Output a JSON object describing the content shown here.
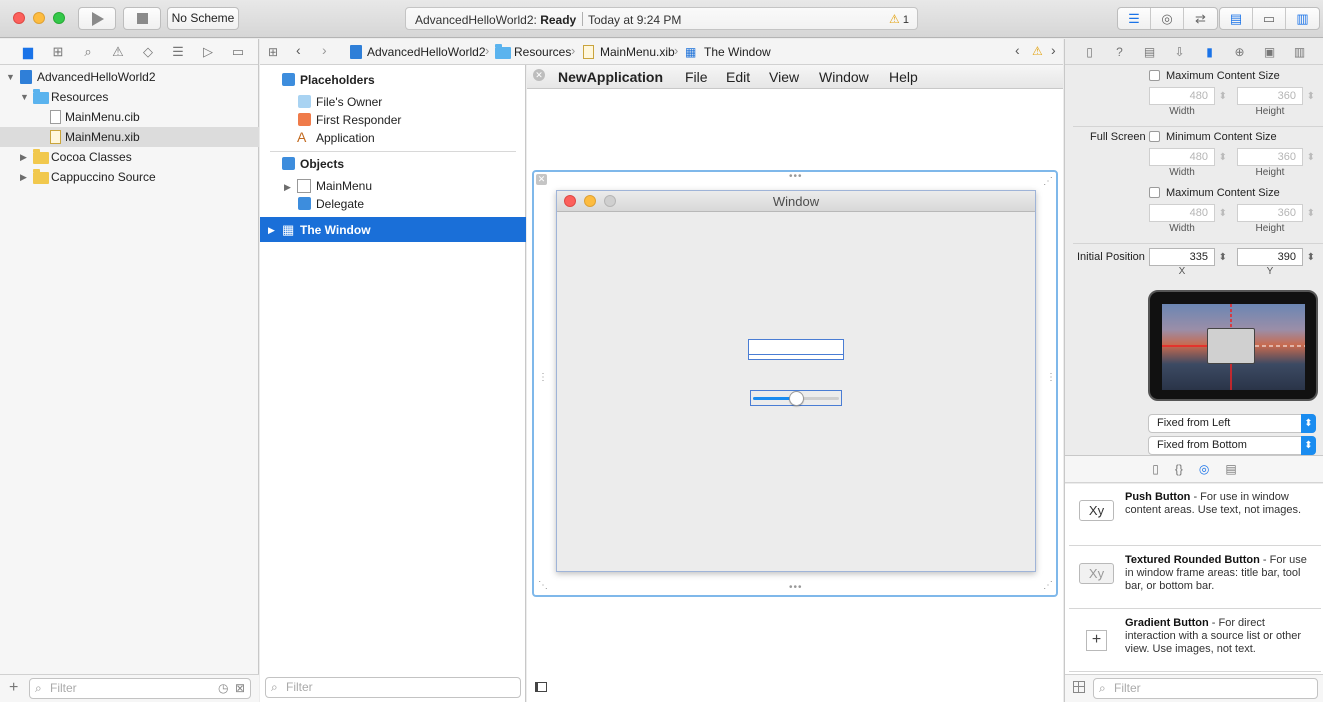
{
  "toolbar": {
    "scheme": "No Scheme",
    "project": "AdvancedHelloWorld2:",
    "status": "Ready",
    "time": "Today at 9:24 PM",
    "warning_count": "1"
  },
  "navigator": {
    "items": [
      {
        "label": "AdvancedHelloWorld2"
      },
      {
        "label": "Resources"
      },
      {
        "label": "MainMenu.cib"
      },
      {
        "label": "MainMenu.xib"
      },
      {
        "label": "Cocoa Classes"
      },
      {
        "label": "Cappuccino Source"
      }
    ],
    "filter_placeholder": "Filter"
  },
  "jumpbar": {
    "crumbs": [
      "AdvancedHelloWorld2",
      "Resources",
      "MainMenu.xib",
      "The Window"
    ]
  },
  "outline": {
    "placeholders_title": "Placeholders",
    "placeholders": [
      "File's Owner",
      "First Responder",
      "Application"
    ],
    "objects_title": "Objects",
    "objects": [
      "MainMenu",
      "Delegate"
    ],
    "selected": "The Window",
    "filter_placeholder": "Filter"
  },
  "canvas": {
    "menu": {
      "app": "NewApplication",
      "items": [
        "File",
        "Edit",
        "View",
        "Window",
        "Help"
      ]
    },
    "window_title": "Window",
    "slider_value": 0.5
  },
  "inspector": {
    "max_content_1": "Maximum Content Size",
    "width_val": "480",
    "height_val": "360",
    "width_label": "Width",
    "height_label": "Height",
    "full_screen_label": "Full Screen",
    "min_content": "Minimum Content Size",
    "max_content_2": "Maximum Content Size",
    "initial_position_label": "Initial Position",
    "pos_x": "335",
    "pos_y": "390",
    "x_label": "X",
    "y_label": "Y",
    "horizontal_option": "Fixed from Left",
    "vertical_option": "Fixed from Bottom",
    "filter_placeholder": "Filter"
  },
  "library": {
    "items": [
      {
        "icon_text": "Xy",
        "name": "Push Button",
        "desc": " - For use in window content areas. Use text, not images."
      },
      {
        "icon_text": "Xy",
        "name": "Textured Rounded Button",
        "desc": " - For use in window frame areas: title bar, tool bar, or bottom bar."
      },
      {
        "icon_text": "+",
        "name": "Gradient Button",
        "desc": " - For direct interaction with a source list or other view. Use images, not text."
      }
    ]
  },
  "colors": {
    "accent": "#1a6fd8",
    "selection_gray": "#dcdcdc"
  }
}
